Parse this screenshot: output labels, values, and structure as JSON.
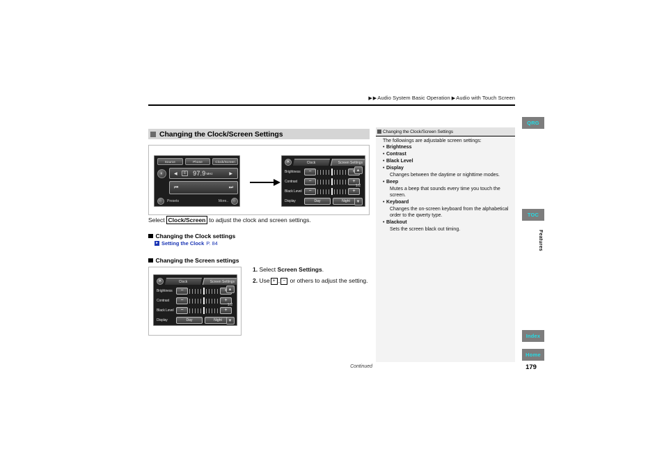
{
  "breadcrumb": {
    "marker": "▶",
    "item1": "Audio System Basic Operation",
    "item2": "Audio with Touch Screen"
  },
  "section": {
    "heading": "Changing the Clock/Screen Settings"
  },
  "figure1": {
    "callout_prefix": "Select",
    "callout_key": "Clock/Screen",
    "radio_screen": {
      "top_buttons": [
        "Source",
        "Phone",
        "Clock/Screen"
      ],
      "antenna_icon": "antenna-icon",
      "seek_left": "◀",
      "band": "①",
      "frequency": "97.9",
      "unit": "MHz",
      "seek_right": "▶",
      "prev_track": "⏮",
      "next_track": "⏭",
      "presets_label": "Presets",
      "more_label": "More.."
    },
    "settings_screen": {
      "close_icon": "✕",
      "tab_clock": "Clock",
      "tab_screen_settings": "Screen Settings",
      "rows": [
        {
          "label": "Brightness",
          "minus": "−",
          "plus": "+"
        },
        {
          "label": "Contrast",
          "minus": "−",
          "plus": "+"
        },
        {
          "label": "Black Level",
          "minus": "−",
          "plus": "+"
        }
      ],
      "display_label": "Display",
      "display_day": "Day",
      "display_night": "Night",
      "scroll_up": "▲",
      "scroll_down": "▼",
      "pager": "1/2"
    }
  },
  "body": {
    "select_prefix": "Select",
    "select_key": "Clock/Screen",
    "select_suffix": "to adjust the clock and screen settings.",
    "sub_heading_clock": "Changing the Clock settings",
    "reference_label": "Setting the Clock",
    "reference_page": "P. 84",
    "sub_heading_screen": "Changing the Screen settings",
    "step1_number": "1.",
    "step1_text_prefix": "Select",
    "step1_bold": "Screen Settings",
    "step1_text_suffix": ".",
    "step2_number": "2.",
    "step2_text_prefix": "Use",
    "step2_key_plus": "+",
    "step2_key_minus": "−",
    "step2_text_suffix": "or others to adjust the setting.",
    "continued": "Continued"
  },
  "infocol": {
    "header": "Changing the Clock/Screen Settings",
    "intro": "The followings are adjustable screen settings:",
    "items": [
      {
        "term": "Brightness",
        "desc": ""
      },
      {
        "term": "Contrast",
        "desc": ""
      },
      {
        "term": "Black Level",
        "desc": ""
      },
      {
        "term": "Display",
        "desc": "Changes between the daytime or nighttime modes."
      },
      {
        "term": "Beep",
        "desc": "Mutes a beep that sounds every time you touch the screen."
      },
      {
        "term": "Keyboard",
        "desc": "Changes the on-screen keyboard from the alphabetical order to the qwerty type."
      },
      {
        "term": "Blackout",
        "desc": "Sets the screen black out timing."
      }
    ]
  },
  "nav": {
    "qrg": "QRG",
    "toc": "TOC",
    "index": "Index",
    "home": "Home",
    "vertical_label": "Features",
    "page_number": "179"
  },
  "colors": {
    "nav_tab_bg": "#7d7d7d",
    "nav_tab_text": "#25dbe4",
    "section_heading_bg": "#d5d5d5",
    "infocol_bg": "#f3f3f3",
    "reference_link": "#1b36b5"
  }
}
